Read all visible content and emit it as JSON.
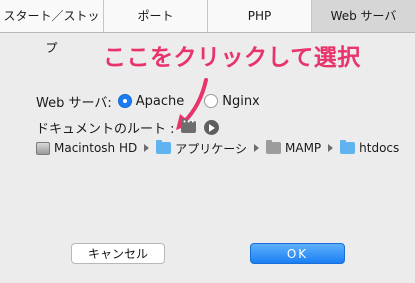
{
  "tabs": [
    {
      "label": "スタート／ストップ",
      "active": false
    },
    {
      "label": "ポート",
      "active": false
    },
    {
      "label": "PHP",
      "active": false
    },
    {
      "label": "Web サーバ",
      "active": true
    }
  ],
  "annotation": {
    "text": "ここをクリックして選択",
    "color": "#e8336b"
  },
  "webserver": {
    "label": "Web サーバ:",
    "options": [
      {
        "label": "Apache",
        "selected": true
      },
      {
        "label": "Nginx",
        "selected": false
      }
    ]
  },
  "docroot": {
    "label": "ドキュメントのルート :"
  },
  "path": [
    "Macintosh HD",
    "アプリケーシ",
    "MAMP",
    "htdocs"
  ],
  "buttons": {
    "cancel": "キャンセル",
    "ok": "OK"
  },
  "colors": {
    "accent": "#1c7cf4",
    "annotation": "#e8336b"
  }
}
